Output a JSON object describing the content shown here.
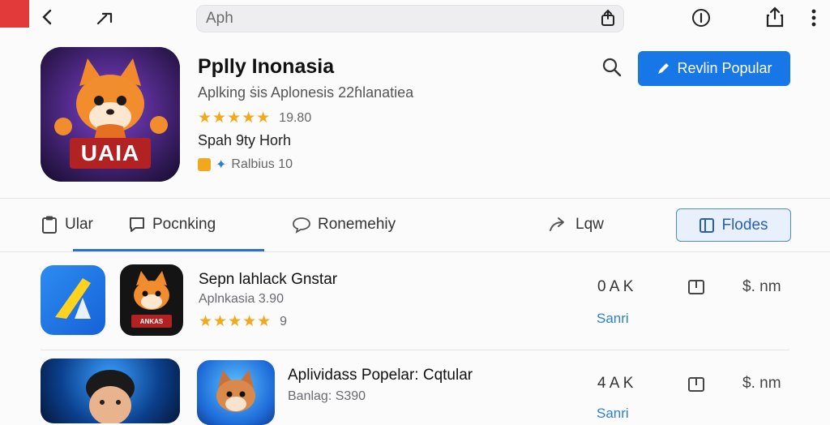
{
  "browser": {
    "url_text": "Aph"
  },
  "app": {
    "title": "Pplly Inonasia",
    "subtitle": "Aplking ṡis Aplonesis 22ɦlanatiea",
    "rating_text": "19.80",
    "developer": "Spah 9ty Horh",
    "badge_text": "Ralbius 10",
    "primary_button": "Revlin Popular",
    "hero_icon_text": "UAIA"
  },
  "tabs": [
    {
      "label": "Ular"
    },
    {
      "label": "Pocnking"
    },
    {
      "label": "Ronemehiy"
    },
    {
      "label": "Lqw"
    },
    {
      "label": "Flodes"
    }
  ],
  "list": [
    {
      "title": "Sepn lahlack Gnstar",
      "subtitle": "Aplnkasia 3.90",
      "stars_count": 5,
      "rating_text": "9",
      "size": "0 A K",
      "link": "Sanri",
      "price": "$. nm",
      "thumb_text": "ANKAS"
    },
    {
      "title": "Aplividass Popelar: Cqtular",
      "subtitle": "Banlag: S390",
      "size": "4 A K",
      "link": "Sanri",
      "price": "$. nm"
    }
  ],
  "colors": {
    "accent": "#1877e6",
    "star": "#f2a81c",
    "link": "#2a7fd4",
    "red_corner": "#e23a3a"
  },
  "icons": {
    "back": "back-arrow-icon",
    "forward": "forward-arrow-icon",
    "share": "share-icon",
    "info": "info-icon",
    "menu": "kebab-menu-icon",
    "search": "search-icon"
  }
}
